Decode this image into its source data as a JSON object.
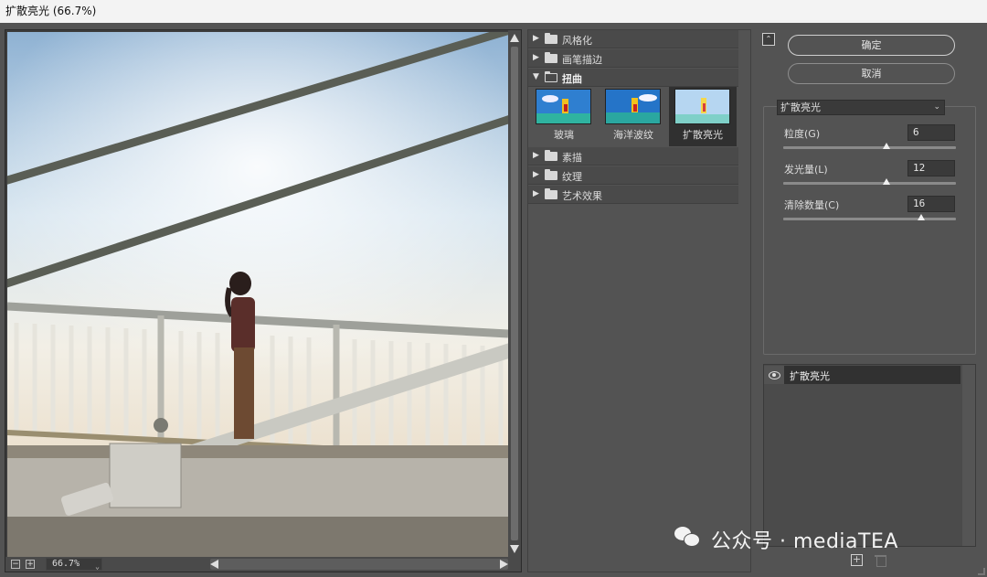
{
  "window": {
    "title": "扩散亮光 (66.7%)"
  },
  "preview": {
    "zoom": "66.7%",
    "zoom_out": "−",
    "zoom_in": "+",
    "zoom_caret": "⌄"
  },
  "gallery": {
    "categories_top": [
      {
        "label": "风格化",
        "expanded": false
      },
      {
        "label": "画笔描边",
        "expanded": false
      },
      {
        "label": "扭曲",
        "expanded": true
      }
    ],
    "thumbnails": [
      {
        "label": "玻璃",
        "selected": false
      },
      {
        "label": "海洋波纹",
        "selected": false
      },
      {
        "label": "扩散亮光",
        "selected": true
      }
    ],
    "categories_bottom": [
      {
        "label": "素描",
        "expanded": false
      },
      {
        "label": "纹理",
        "expanded": false
      },
      {
        "label": "艺术效果",
        "expanded": false
      }
    ],
    "arrow_collapsed": "▶",
    "arrow_expanded": "▼"
  },
  "panel": {
    "collapse_glyph": "⌃",
    "ok_label": "确定",
    "cancel_label": "取消",
    "filter_select": "扩散亮光",
    "filter_caret": "⌄",
    "params": [
      {
        "label": "粒度(G)",
        "value": "6",
        "slider_fraction": 0.6
      },
      {
        "label": "发光量(L)",
        "value": "12",
        "slider_fraction": 0.6
      },
      {
        "label": "清除数量(C)",
        "value": "16",
        "slider_fraction": 0.8
      }
    ],
    "layer_name": "扩散亮光",
    "new_layer_glyph": "+"
  },
  "watermark": {
    "text": "公众号 · mediaTEA"
  },
  "colors": {
    "bg": "#535353",
    "selected_thumb": "#303030",
    "sky": "#9bbbd8",
    "railing": "#e8e6e0"
  }
}
